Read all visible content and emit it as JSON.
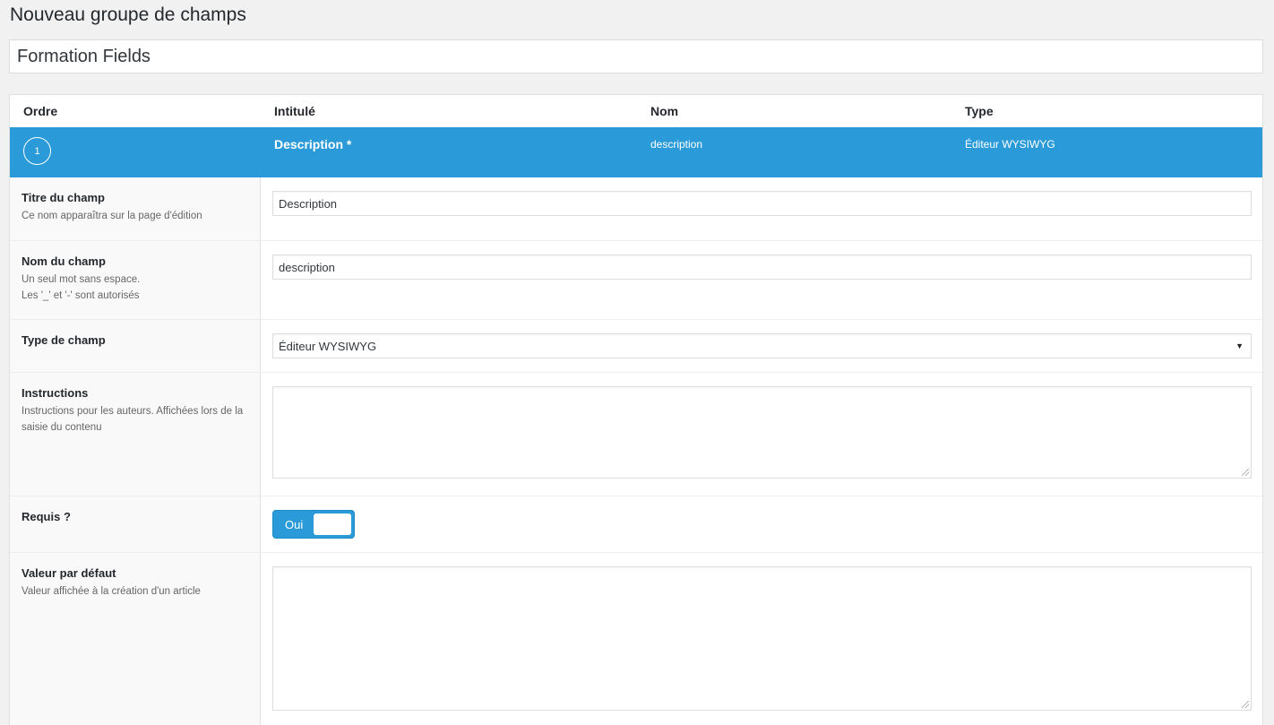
{
  "page": {
    "title": "Nouveau groupe de champs",
    "group_title_value": "Formation Fields"
  },
  "table": {
    "headers": [
      "Ordre",
      "Intitulé",
      "Nom",
      "Type"
    ]
  },
  "field": {
    "order": "1",
    "label": "Description *",
    "name": "description",
    "type": "Éditeur WYSIWYG",
    "row_color": "#2a9bd8"
  },
  "settings": {
    "title": {
      "label": "Titre du champ",
      "description": "Ce nom apparaîtra sur la page d'édition",
      "value": "Description"
    },
    "name": {
      "label": "Nom du champ",
      "description_line1": "Un seul mot sans espace.",
      "description_line2": "Les '_' et '-' sont autorisés",
      "value": "description"
    },
    "type": {
      "label": "Type de champ",
      "value": "Éditeur WYSIWYG"
    },
    "instructions": {
      "label": "Instructions",
      "description": "Instructions pour les auteurs. Affichées lors de la saisie du contenu",
      "value": ""
    },
    "required": {
      "label": "Requis ?",
      "toggle_label": "Oui",
      "state": "on"
    },
    "default_value": {
      "label": "Valeur par défaut",
      "description": "Valeur affichée à la création d'un article",
      "value": ""
    }
  }
}
